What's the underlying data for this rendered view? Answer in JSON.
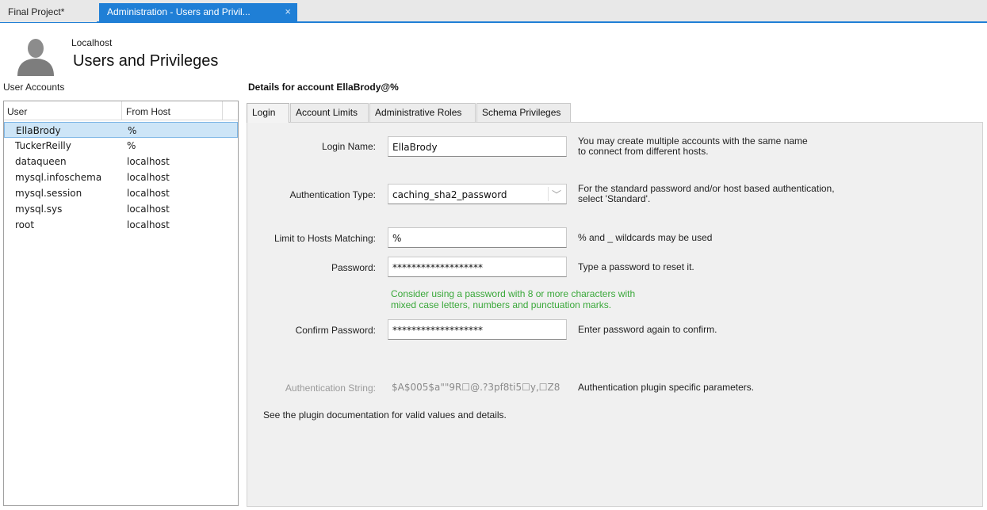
{
  "tabs": {
    "doc_tab": "Final Project*",
    "admin_tab": "Administration - Users and Privil...",
    "close_glyph": "×"
  },
  "header": {
    "host": "Localhost",
    "title": "Users and Privileges"
  },
  "accounts": {
    "label": "User Accounts",
    "columns": {
      "user": "User",
      "host": "From Host"
    },
    "rows": [
      {
        "user": "EllaBrody",
        "host": "%"
      },
      {
        "user": "TuckerReilly",
        "host": "%"
      },
      {
        "user": "dataqueen",
        "host": "localhost"
      },
      {
        "user": "mysql.infoschema",
        "host": "localhost"
      },
      {
        "user": "mysql.session",
        "host": "localhost"
      },
      {
        "user": "mysql.sys",
        "host": "localhost"
      },
      {
        "user": "root",
        "host": "localhost"
      }
    ]
  },
  "details": {
    "title": "Details for account EllaBrody@%",
    "tabs": {
      "login": "Login",
      "limits": "Account Limits",
      "roles": "Administrative Roles",
      "schema": "Schema Privileges"
    },
    "login_name": {
      "label": "Login Name:",
      "value": "EllaBrody",
      "help1": "You may create multiple accounts with the same name",
      "help2": "to connect from different hosts."
    },
    "auth_type": {
      "label": "Authentication Type:",
      "value": "caching_sha2_password",
      "help1": "For the standard password and/or host based authentication,",
      "help2": "select 'Standard'."
    },
    "host_match": {
      "label": "Limit to Hosts Matching:",
      "value": "%",
      "help": "% and _ wildcards may be used"
    },
    "password": {
      "label": "Password:",
      "value": "*******************",
      "help": "Type a password to reset it.",
      "hint1": "Consider using a password with 8 or more characters with",
      "hint2": "mixed case letters, numbers and punctuation marks."
    },
    "confirm": {
      "label": "Confirm Password:",
      "value": "*******************",
      "help": "Enter password again to confirm."
    },
    "auth_string": {
      "label": "Authentication String:",
      "value": "$A$005$a\"\"9R☐@.?3pf8ti5☐y,☐Z8",
      "help": "Authentication plugin specific parameters."
    },
    "footer_note": "See the plugin documentation for valid values and details."
  },
  "colors": {
    "accent": "#1f7fd6",
    "selection": "#cde5f7",
    "hint_green": "#3aa83a"
  }
}
